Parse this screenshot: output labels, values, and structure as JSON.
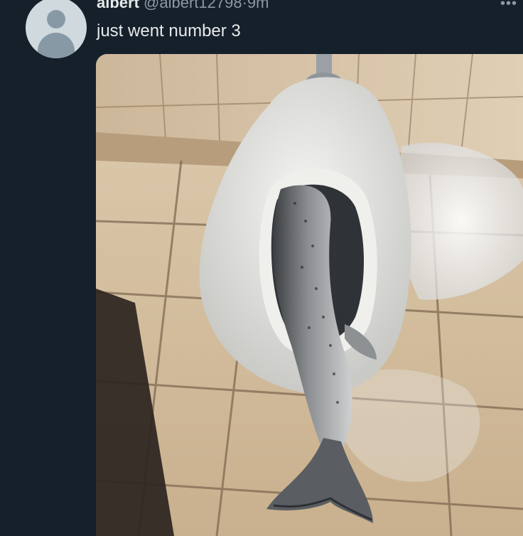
{
  "post": {
    "author": {
      "display_name": "albert",
      "handle": "@albert12798",
      "separator": "·",
      "time": "9m"
    },
    "text": "just went number 3",
    "more_icon": "more-dots-icon",
    "media_alt_icon": "photo-salmon-in-toilet"
  }
}
